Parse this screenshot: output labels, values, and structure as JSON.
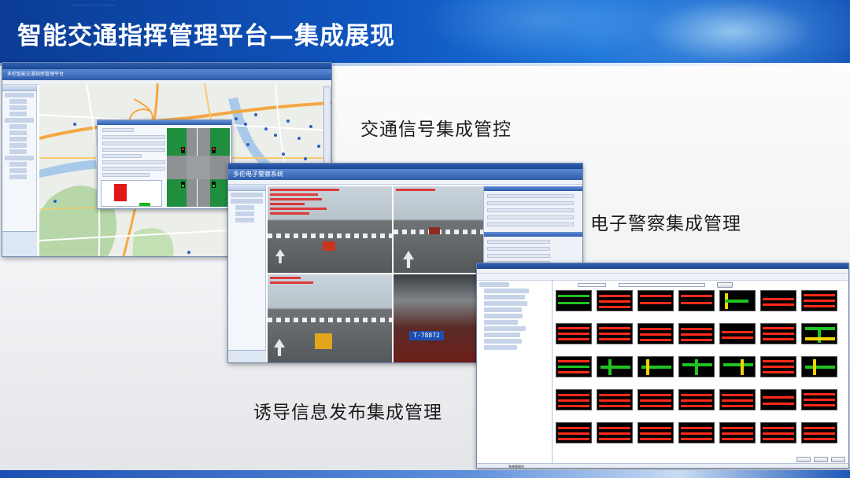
{
  "slide": {
    "title": "智能交通指挥管理平台—集成展现",
    "header_small_text": "·····································"
  },
  "captions": {
    "signal": "交通信号集成管控",
    "police": "电子警察集成管理",
    "guidance": "诱导信息发布集成管理"
  },
  "screens": {
    "signal": {
      "window_title": "多伦智能交通指挥管理平台"
    },
    "police": {
      "window_title": "多伦电子警察系统",
      "plate": "T·78872"
    },
    "guidance": {
      "status_text": "系统管理员"
    }
  },
  "colors": {
    "header_blue": "#0f56c0",
    "green_light": "#1e8e3c",
    "led_red": "#ff2a1a",
    "led_green": "#21c321",
    "led_yellow": "#f2d400"
  }
}
